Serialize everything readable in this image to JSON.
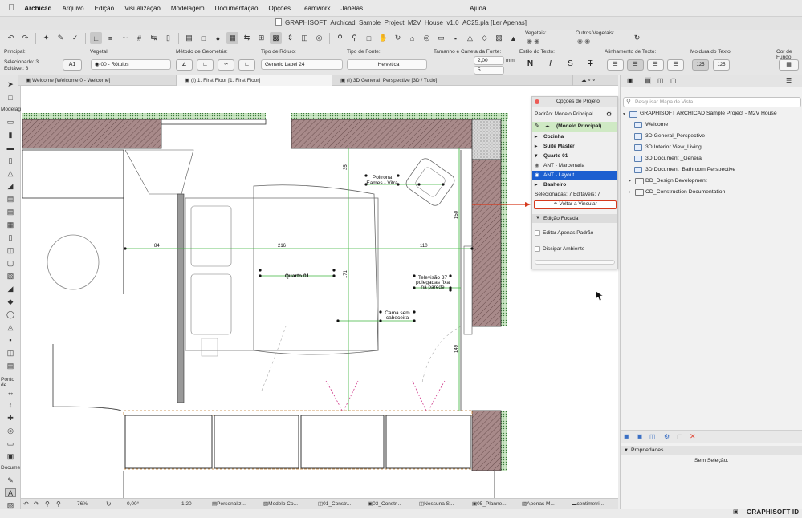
{
  "menubar": {
    "app": "Archicad",
    "items": [
      "Arquivo",
      "Edição",
      "Visualização",
      "Modelagem",
      "Documentação",
      "Opções",
      "Teamwork",
      "Janelas",
      "Ajuda"
    ]
  },
  "window": {
    "title": "GRAPHISOFT_Archicad_Sample_Project_M2V_House_v1.0_AC25.pla [Ler Apenas]"
  },
  "toolbar": {
    "vegetais_label": "Vegetais:",
    "outros_label": "Outros Vegetais:"
  },
  "infobox": {
    "principal_label": "Principal:",
    "selecionados": "Selecionado: 3",
    "editavel": "Editável: 3",
    "a1_button": "A1",
    "vegetal_label": "Vegetal:",
    "vegetal_value": "00 - Rótulos",
    "metodo_label": "Método de Geometria:",
    "tipo_rotulo_label": "Tipo de Rótulo:",
    "tipo_rotulo_value": "Generic Label 24",
    "tipo_fonte_label": "Tipo de Fonte:",
    "tipo_fonte_value": "Helvetica",
    "tamanho_label": "Tamanho e Caneta da Fonte:",
    "tamanho_value": "2,00",
    "tamanho_unit": "mm",
    "caneta_value": "5",
    "estilo_label": "Estilo do Texto:",
    "alinhamento_label": "Alinhamento de Texto:",
    "moldura_label": "Moldura do Texto:",
    "cor_label": "Cor de Fundo",
    "style_buttons": [
      "N",
      "I",
      "S",
      "T"
    ],
    "moldura_a": "125",
    "moldura_b": "125"
  },
  "tabs": [
    {
      "label": "Welcome [Welcome 0 - Welcome]"
    },
    {
      "label": "(I) 1. First Floor [1. First Floor]"
    },
    {
      "label": "(I) 3D General_Perspective [3D / Tudo]"
    }
  ],
  "toolbox": {
    "cat_modelagem": "Modelag",
    "cat_ponto": "Ponto de",
    "cat_docume": "Docume"
  },
  "plan": {
    "labels": {
      "poltrona": [
        "Poltrona",
        "Eames - Vitra"
      ],
      "quarto": "Quarto 01",
      "televisao": [
        "Televisão 37",
        "polegadas fixa",
        "na parede"
      ],
      "cama": [
        "Cama sem",
        "cabeceira"
      ]
    },
    "dims": {
      "d84": "84",
      "d216": "216",
      "d110": "110",
      "d35": "35",
      "d150": "150",
      "d171": "171",
      "d149": "149"
    }
  },
  "palette": {
    "title": "Opções de Projeto",
    "padrao_label": "Padrão: Modelo Principal",
    "modelo_principal": "(Modelo Principal)",
    "options": [
      "Cozinha",
      "Suíte Master",
      "Quarto 01",
      "ANT - Marcenaria",
      "ANT - Layout",
      "Banheiro"
    ],
    "status": "Selecionadas: 7 Editáveis: 7",
    "voltar_button": "Voltar a Vincular",
    "edicao_focada": "Edição Focada",
    "editar_apenas": "Editar Apenas Padrão",
    "dissipar": "Dissipar Ambiente"
  },
  "navigator": {
    "search_placeholder": "Pesquisar Mapa de Vista",
    "root": "GRAPHISOFT ARCHICAD Sample Project - M2V House",
    "items": [
      "Welcome",
      "3D General_Perspective",
      "3D Interior View_Living",
      "3D Document _General",
      "3D Document_Bathroom Perspective"
    ],
    "folders": [
      "DD_Design Development",
      "CD_Construction Documentation"
    ],
    "properties_label": "Propriedades",
    "no_selection": "Sem Seleção."
  },
  "statusbar": {
    "zoom": "76%",
    "angle": "0,00°",
    "scale": "1:20",
    "items": [
      "Personaliz...",
      "Modelo Co...",
      "01_Constr...",
      "03_Constr...",
      "Nessuna S...",
      "05_Planne...",
      "Apenas M...",
      "centimetri..."
    ]
  },
  "brand": {
    "name": "GRAPHISOFT ID"
  }
}
